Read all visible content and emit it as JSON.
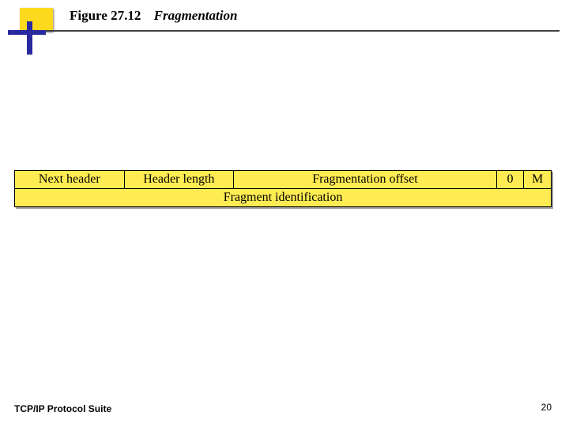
{
  "title": {
    "figure_number": "Figure 27.12",
    "caption": "Fragmentation"
  },
  "frag_header": {
    "row1": {
      "next_header": "Next header",
      "header_length": "Header length",
      "fragmentation_offset": "Fragmentation offset",
      "zero": "0",
      "m": "M"
    },
    "row2": {
      "fragment_identification": "Fragment identification"
    }
  },
  "footer": {
    "suite": "TCP/IP Protocol Suite",
    "page": "20"
  }
}
